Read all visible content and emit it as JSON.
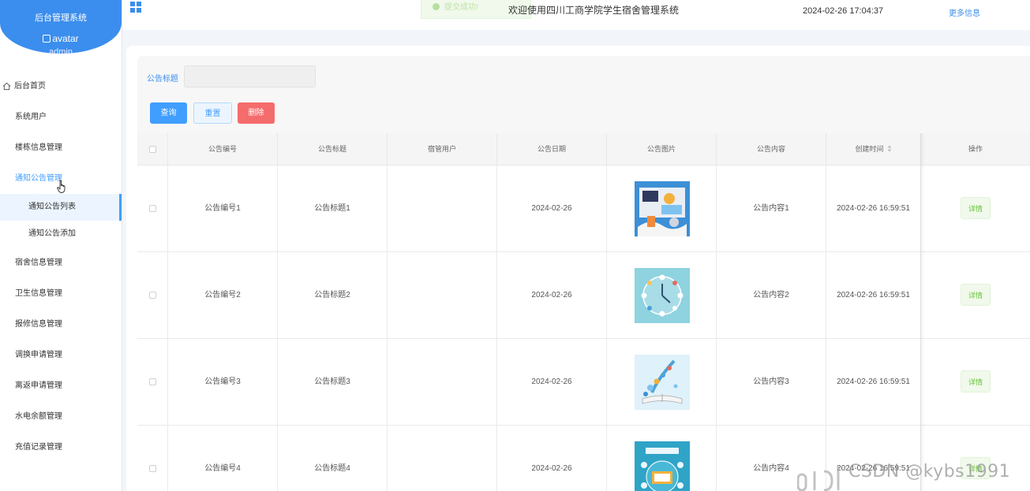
{
  "brand": {
    "title": "后台管理系统",
    "avatar_alt": "avatar",
    "username": "admin"
  },
  "sidebar": {
    "items": [
      {
        "label": "后台首页"
      },
      {
        "label": "系统用户"
      },
      {
        "label": "楼栋信息管理"
      },
      {
        "label": "通知公告管理"
      },
      {
        "label": "通知公告列表"
      },
      {
        "label": "通知公告添加"
      },
      {
        "label": "宿舍信息管理"
      },
      {
        "label": "卫生信息管理"
      },
      {
        "label": "报修信息管理"
      },
      {
        "label": "调换申请管理"
      },
      {
        "label": "离返申请管理"
      },
      {
        "label": "水电余额管理"
      },
      {
        "label": "充值记录管理"
      }
    ]
  },
  "topbar": {
    "toast": "提交成功!",
    "welcome": "欢迎使用四川工商学院学生宿舍管理系统",
    "datetime": "2024-02-26 17:04:37",
    "more_info": "更多信息"
  },
  "search": {
    "label": "公告标题",
    "value": ""
  },
  "buttons": {
    "query": "查询",
    "reset": "重置",
    "delete": "删除"
  },
  "table": {
    "headers": [
      "公告编号",
      "公告标题",
      "宿管用户",
      "公告日期",
      "公告图片",
      "公告内容",
      "创建时间",
      "操作"
    ],
    "rows": [
      {
        "number": "公告编号1",
        "title": "公告标题1",
        "user": "",
        "date": "2024-02-26",
        "image": "announcement-image-1",
        "content": "公告内容1",
        "created": "2024-02-26 16:59:51",
        "action": "详情"
      },
      {
        "number": "公告编号2",
        "title": "公告标题2",
        "user": "",
        "date": "2024-02-26",
        "image": "announcement-image-2",
        "content": "公告内容2",
        "created": "2024-02-26 16:59:51",
        "action": "详情"
      },
      {
        "number": "公告编号3",
        "title": "公告标题3",
        "user": "",
        "date": "2024-02-26",
        "image": "announcement-image-3",
        "content": "公告内容3",
        "created": "2024-02-26 16:59:51",
        "action": "详情"
      },
      {
        "number": "公告编号4",
        "title": "公告标题4",
        "user": "",
        "date": "2024-02-26",
        "image": "announcement-image-4",
        "content": "公告内容4",
        "created": "2024-02-26 16:59:51",
        "action": "详情"
      }
    ]
  },
  "watermark": "CSDN @kybs1991",
  "colors": {
    "primary": "#409eff",
    "brand": "#3b8eed",
    "danger": "#f56c6c",
    "success": "#67c23a"
  }
}
